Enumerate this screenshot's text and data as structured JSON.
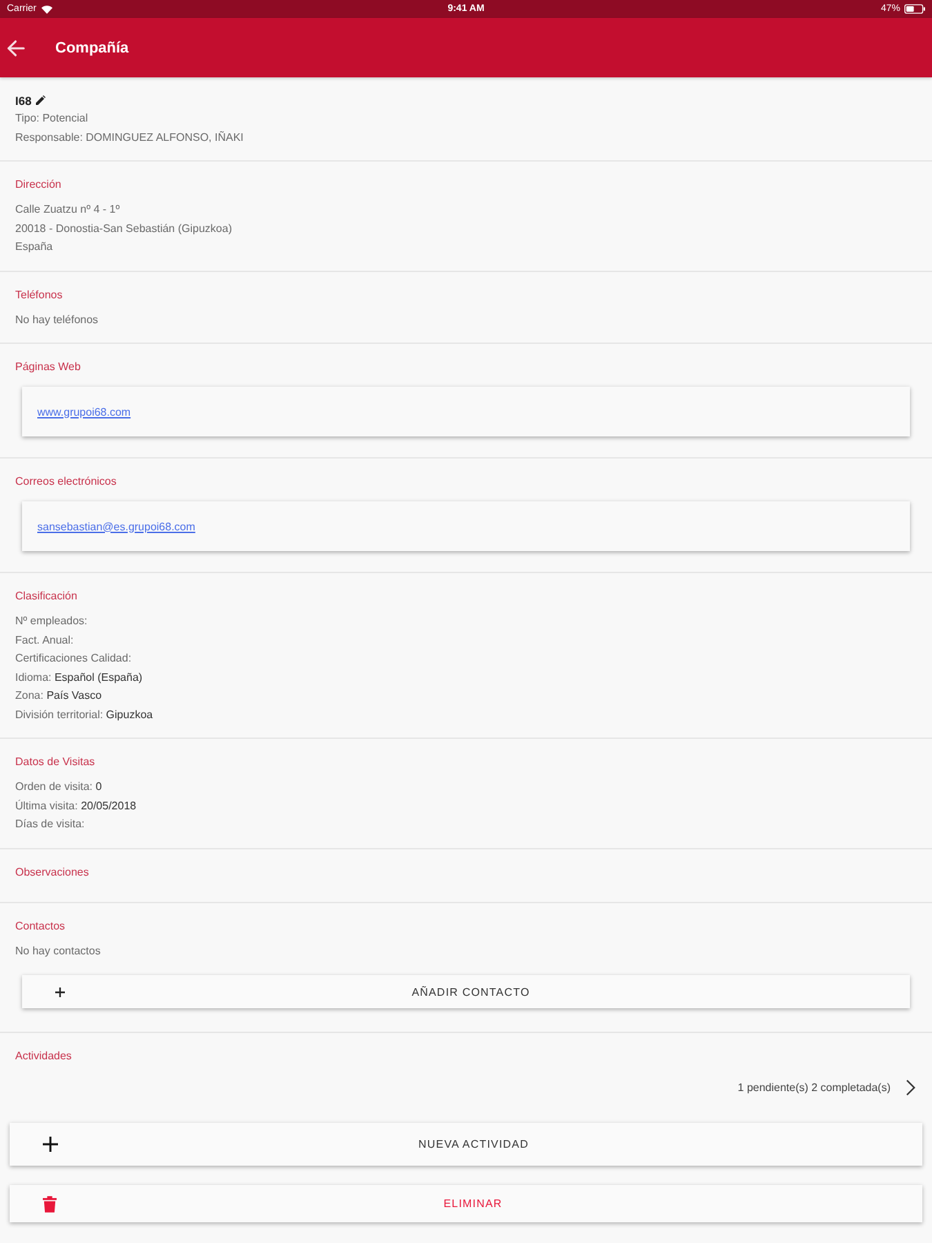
{
  "status_bar": {
    "carrier": "Carrier",
    "time": "9:41 AM",
    "battery": "47%"
  },
  "header": {
    "title": "Compañía"
  },
  "summary": {
    "name": "I68",
    "lines": [
      "Tipo: Potencial",
      "Responsable: DOMINGUEZ ALFONSO, IÑAKI"
    ]
  },
  "sections": [
    {
      "title": "Dirección",
      "lines": [
        "Calle Zuatzu nº 4 - 1º",
        "20018 - Donostia-San Sebastián (Gipuzkoa)",
        "España"
      ]
    },
    {
      "title": "Teléfonos",
      "lines": [
        "No hay teléfonos"
      ]
    },
    {
      "title": "Páginas Web",
      "links": [
        "www.grupoi68.com"
      ]
    },
    {
      "title": "Correos electrónicos",
      "links": [
        "sansebastian@es.grupoi68.com"
      ]
    },
    {
      "title": "Clasificación",
      "fields": [
        {
          "label": "Nº empleados:"
        },
        {
          "label": "Fact. Anual:"
        },
        {
          "label": "Certificaciones Calidad:"
        },
        {
          "label": "Idioma:",
          "value": "Español (España)"
        },
        {
          "label": "Zona:",
          "value": "País Vasco"
        },
        {
          "label": "División territorial:",
          "value": "Gipuzkoa"
        }
      ]
    },
    {
      "title": "Datos de Visitas",
      "fields": [
        {
          "label": "Orden de visita:",
          "value": "0"
        },
        {
          "label": "Última visita:",
          "value": "20/05/2018"
        },
        {
          "label": "Días de visita:"
        }
      ]
    },
    {
      "title": "Observaciones"
    },
    {
      "title": "Contactos",
      "lines": [
        "No hay contactos"
      ],
      "button": "AÑADIR CONTACTO"
    },
    {
      "title": "Actividades",
      "summary": "1 pendiente(s) 2 completada(s)"
    }
  ],
  "actions": [
    {
      "kind": "add",
      "label": "NUEVA ACTIVIDAD"
    },
    {
      "kind": "delete",
      "label": "ELIMINAR"
    }
  ]
}
